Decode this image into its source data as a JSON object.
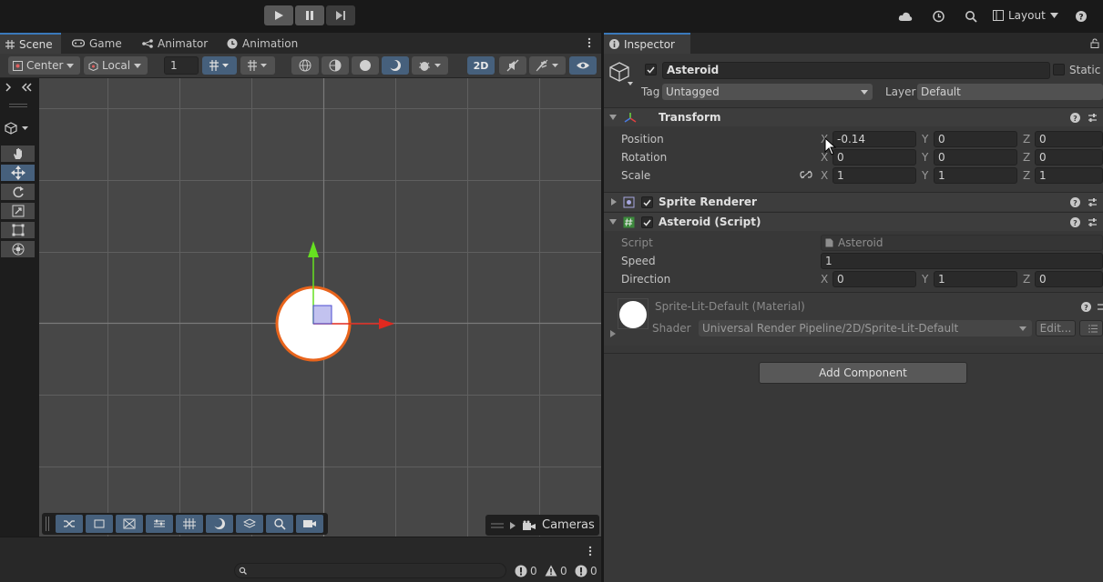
{
  "topbar": {
    "layout_label": "Layout"
  },
  "scene_tabs": [
    {
      "label": "Scene"
    },
    {
      "label": "Game"
    },
    {
      "label": "Animator"
    },
    {
      "label": "Animation"
    }
  ],
  "scene_toolbar": {
    "pivot_label": "Center",
    "space_label": "Local",
    "grid_snap_value": "1",
    "mode_2d_label": "2D"
  },
  "overlay": {
    "cameras_label": "Cameras"
  },
  "console": {
    "log_count": "0",
    "warning_count": "0",
    "error_count": "0"
  },
  "inspector": {
    "tab_label": "Inspector",
    "object_name": "Asteroid",
    "static_label": "Static",
    "tag_label": "Tag",
    "tag_value": "Untagged",
    "layer_label": "Layer",
    "layer_value": "Default",
    "transform": {
      "title": "Transform",
      "position_label": "Position",
      "rotation_label": "Rotation",
      "scale_label": "Scale",
      "position": {
        "x": "-0.14",
        "y": "0",
        "z": "0"
      },
      "rotation": {
        "x": "0",
        "y": "0",
        "z": "0"
      },
      "scale": {
        "x": "1",
        "y": "1",
        "z": "1"
      }
    },
    "axes": {
      "x": "X",
      "y": "Y",
      "z": "Z"
    },
    "sprite_renderer": {
      "title": "Sprite Renderer"
    },
    "script_component": {
      "title": "Asteroid (Script)",
      "script_label": "Script",
      "script_value": "Asteroid",
      "speed_label": "Speed",
      "speed_value": "1",
      "direction_label": "Direction",
      "direction": {
        "x": "0",
        "y": "1",
        "z": "0"
      }
    },
    "material": {
      "title": "Sprite-Lit-Default (Material)",
      "shader_label": "Shader",
      "shader_value": "Universal Render Pipeline/2D/Sprite-Lit-Default",
      "edit_label": "Edit..."
    },
    "add_component_label": "Add Component"
  },
  "colors": {
    "accent": "#3a79bb",
    "active_button": "#46607c",
    "asteroid_outline": "#e8641c",
    "gizmo_x": "#e0291f",
    "gizmo_y": "#66e020"
  }
}
